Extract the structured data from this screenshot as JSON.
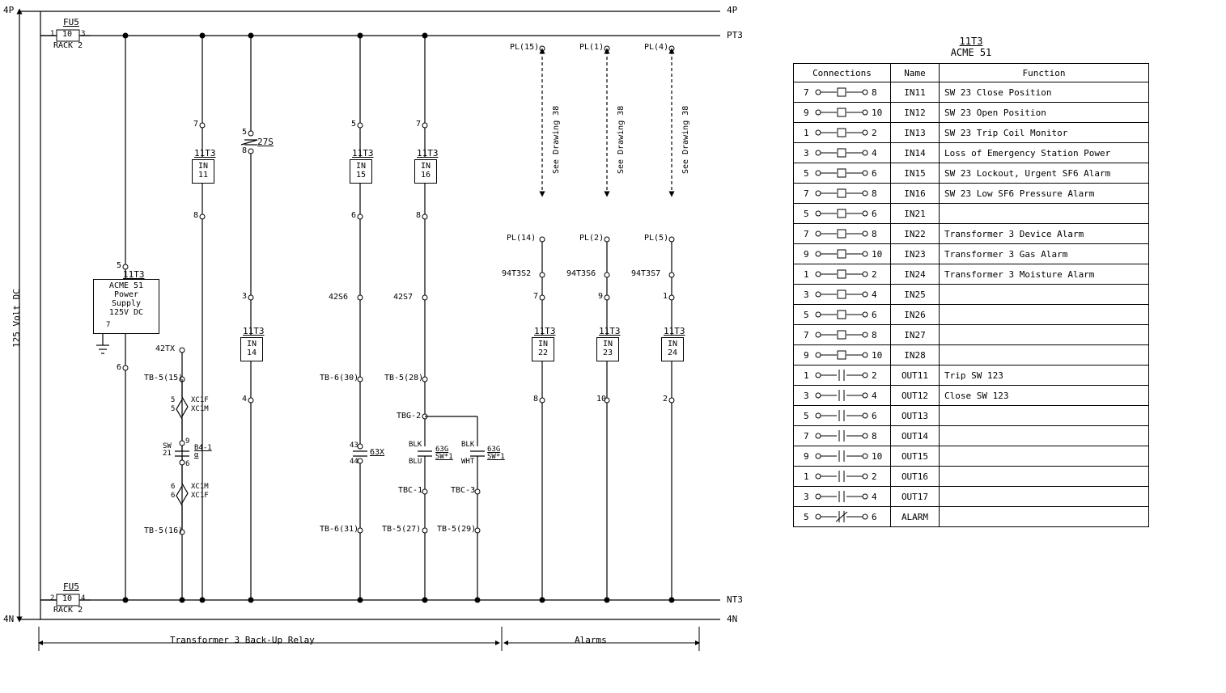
{
  "buses": {
    "top4P_left": "4P",
    "top4P_right": "4P",
    "PT3": "PT3",
    "bot4N_left": "4N",
    "bot4N_right": "4N",
    "NT3": "NT3"
  },
  "fuse_top": {
    "title": "FU5",
    "rating": "10",
    "lterm": "1",
    "rterm": "3",
    "rack": "RACK 2"
  },
  "fuse_bot": {
    "title": "FU5",
    "rating": "10",
    "lterm": "2",
    "rterm": "4",
    "rack": "RACK 2"
  },
  "dc_label": "125 Volt DC",
  "ps": {
    "ref": "11T3",
    "l1": "ACME 51",
    "l2": "Power",
    "l3": "Supply",
    "l4": "125V DC",
    "term": "7",
    "top": "5",
    "bot": "6"
  },
  "br1": {
    "ref": "11T3",
    "name": "IN\n11",
    "top": "7",
    "mid": "8"
  },
  "br2": {
    "ref27s": "27S",
    "tt": "5",
    "tb": "8",
    "thr": "3",
    "ref": "11T3",
    "name": "IN\n14",
    "four": "4"
  },
  "br3": {
    "ref": "11T3",
    "name": "IN\n15",
    "top": "5",
    "mid": "6",
    "s": "42S6",
    "cap": "63X",
    "t43": "43",
    "t44": "44",
    "tbtop": "TB-6(30)",
    "tbbot": "TB-6(31)"
  },
  "br4": {
    "ref": "11T3",
    "name": "IN\n16",
    "top": "7",
    "mid": "8",
    "s": "42S7",
    "tbtop": "TB-5(28)",
    "tbg2": "TBG-2",
    "tbc1": "TBC-1",
    "tbc3": "TBC-3",
    "tbs27": "TB-5(27)",
    "tbs29": "TB-5(29)",
    "cap1a": "BLK",
    "cap1b": "BLU",
    "cap1r": "63G\nSW*1",
    "cap2a": "BLK",
    "cap2b": "WHT",
    "cap2r": "63G\nSW*1"
  },
  "mid_extra": {
    "n42tx": "42TX",
    "tb515": "TB-5(15)",
    "xc_up_a": "XC1F",
    "xc_up_b": "XC1M",
    "xc_up_l1": "5",
    "xc_up_l2": "5",
    "sw": "SW\n21",
    "sw_top": "9",
    "sw_bot": "6",
    "sw_ref": "B4-1\nα",
    "xc_dn_a": "XC1M",
    "xc_dn_b": "XC1F",
    "xc_dn_l1": "6",
    "xc_dn_l2": "6",
    "tb516": "TB-5(16)"
  },
  "alarms": {
    "labels": [
      "PL(15)",
      "PL(1)",
      "PL(4)"
    ],
    "see": "See Drawing 38",
    "pl2": [
      "PL(14)",
      "PL(2)",
      "PL(5)"
    ],
    "rel": [
      "94T3S2",
      "94T3S6",
      "94T3S7"
    ],
    "nTop": [
      "7",
      "9",
      "1"
    ],
    "nBot": [
      "8",
      "10",
      "2"
    ],
    "ref": "11T3",
    "names": [
      "IN\n22",
      "IN\n23",
      "IN\n24"
    ]
  },
  "sections": {
    "left": "Transformer 3 Back-Up Relay",
    "right": "Alarms"
  },
  "table": {
    "ref": "11T3",
    "sub": "ACME 51",
    "h1": "Connections",
    "h2": "Name",
    "h3": "Function",
    "rows": [
      {
        "c": [
          "7",
          "8"
        ],
        "t": "sq",
        "name": "IN11",
        "fn": "SW 23 Close Position"
      },
      {
        "c": [
          "9",
          "10"
        ],
        "t": "sq",
        "name": "IN12",
        "fn": "SW 23 Open Position"
      },
      {
        "c": [
          "1",
          "2"
        ],
        "t": "sq",
        "name": "IN13",
        "fn": "SW 23 Trip Coil Monitor"
      },
      {
        "c": [
          "3",
          "4"
        ],
        "t": "sq",
        "name": "IN14",
        "fn": "Loss of Emergency Station Power"
      },
      {
        "c": [
          "5",
          "6"
        ],
        "t": "sq",
        "name": "IN15",
        "fn": "SW 23 Lockout, Urgent SF6 Alarm"
      },
      {
        "c": [
          "7",
          "8"
        ],
        "t": "sq",
        "name": "IN16",
        "fn": "SW 23 Low SF6 Pressure Alarm"
      },
      {
        "c": [
          "5",
          "6"
        ],
        "t": "sq",
        "name": "IN21",
        "fn": ""
      },
      {
        "c": [
          "7",
          "8"
        ],
        "t": "sq",
        "name": "IN22",
        "fn": "Transformer 3 Device Alarm"
      },
      {
        "c": [
          "9",
          "10"
        ],
        "t": "sq",
        "name": "IN23",
        "fn": "Transformer 3 Gas Alarm"
      },
      {
        "c": [
          "1",
          "2"
        ],
        "t": "sq",
        "name": "IN24",
        "fn": "Transformer 3 Moisture Alarm"
      },
      {
        "c": [
          "3",
          "4"
        ],
        "t": "sq",
        "name": "IN25",
        "fn": ""
      },
      {
        "c": [
          "5",
          "6"
        ],
        "t": "sq",
        "name": "IN26",
        "fn": ""
      },
      {
        "c": [
          "7",
          "8"
        ],
        "t": "sq",
        "name": "IN27",
        "fn": ""
      },
      {
        "c": [
          "9",
          "10"
        ],
        "t": "sq",
        "name": "IN28",
        "fn": ""
      },
      {
        "c": [
          "1",
          "2"
        ],
        "t": "no",
        "name": "OUT11",
        "fn": "Trip SW 123"
      },
      {
        "c": [
          "3",
          "4"
        ],
        "t": "no",
        "name": "OUT12",
        "fn": "Close SW 123"
      },
      {
        "c": [
          "5",
          "6"
        ],
        "t": "no",
        "name": "OUT13",
        "fn": ""
      },
      {
        "c": [
          "7",
          "8"
        ],
        "t": "no",
        "name": "OUT14",
        "fn": ""
      },
      {
        "c": [
          "9",
          "10"
        ],
        "t": "no",
        "name": "OUT15",
        "fn": ""
      },
      {
        "c": [
          "1",
          "2"
        ],
        "t": "no",
        "name": "OUT16",
        "fn": ""
      },
      {
        "c": [
          "3",
          "4"
        ],
        "t": "no",
        "name": "OUT17",
        "fn": ""
      },
      {
        "c": [
          "5",
          "6"
        ],
        "t": "nc",
        "name": "ALARM",
        "fn": ""
      }
    ]
  }
}
